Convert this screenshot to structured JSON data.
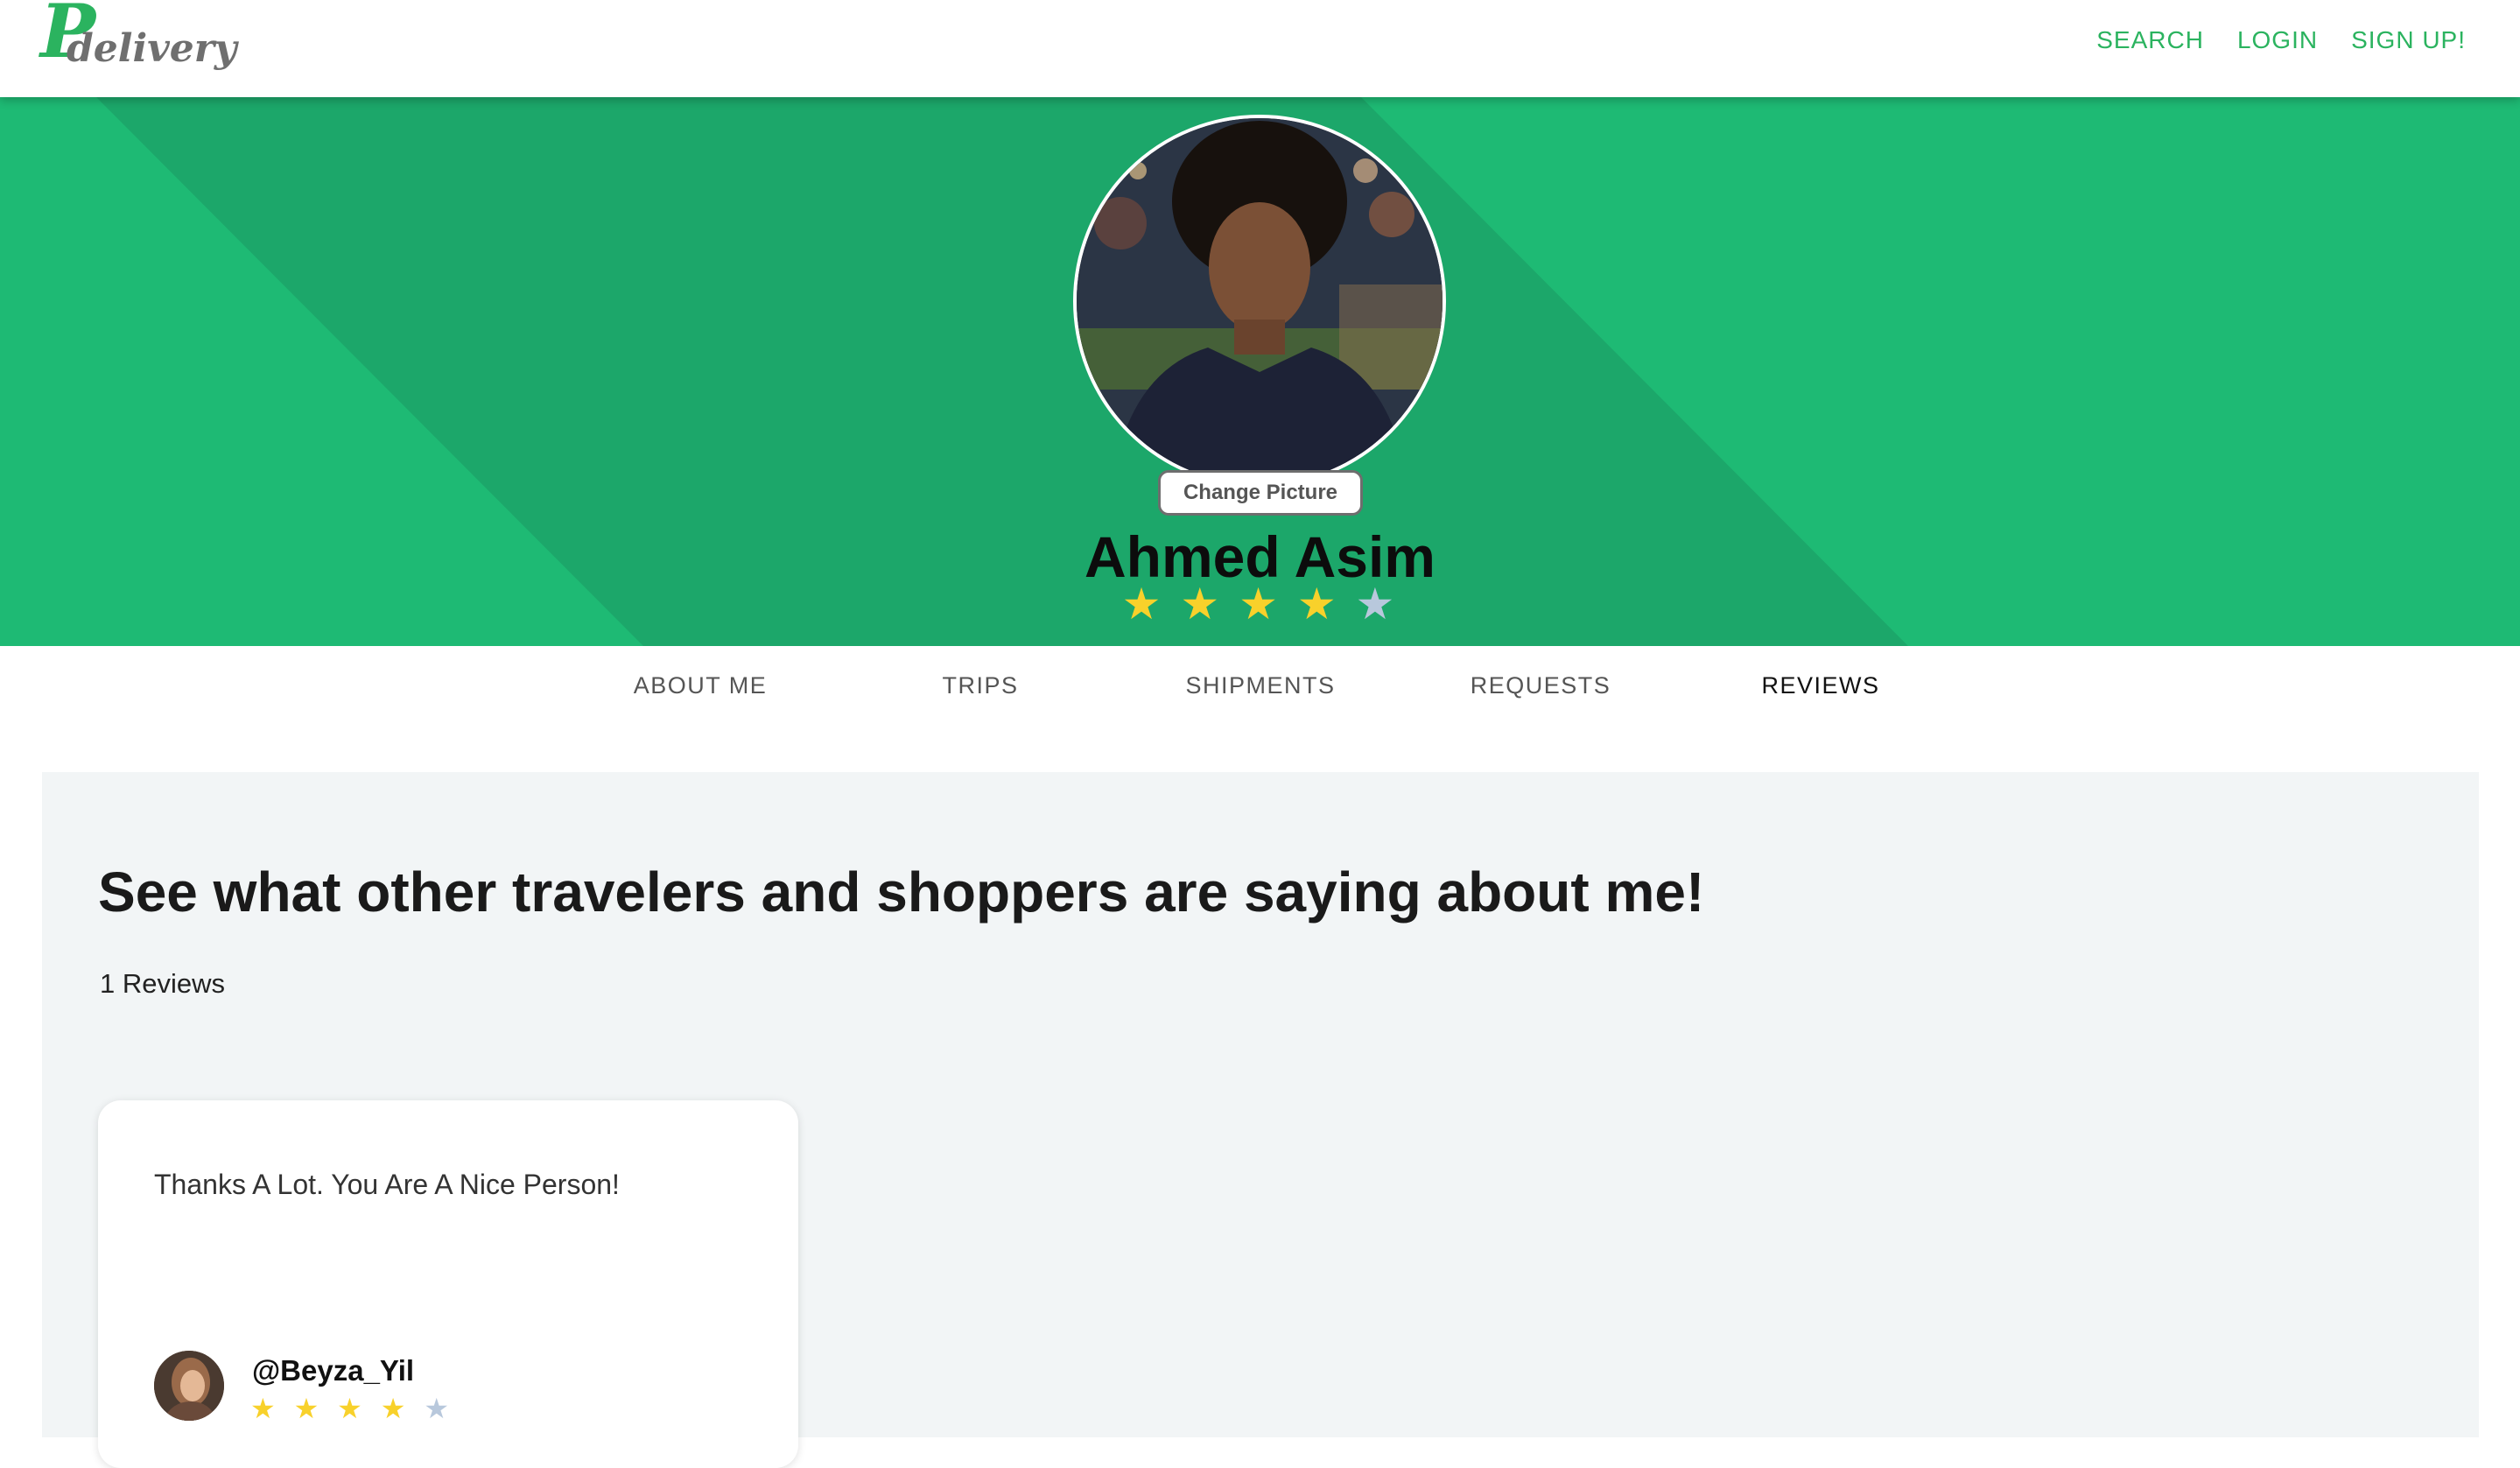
{
  "brand": {
    "logo_letter": "P",
    "logo_word": "delivery",
    "green": "#2bb35f",
    "hero_green": "#1eba74",
    "hero_band": "#1ca76a"
  },
  "nav": {
    "search": "SEARCH",
    "login": "LOGIN",
    "signup": "SIGN UP!"
  },
  "profile": {
    "avatar_icon": "profile-photo",
    "change_picture_label": "Change Picture",
    "name": "Ahmed Asim",
    "rating": 4,
    "rating_max": 5,
    "stars": [
      "★",
      "★",
      "★",
      "★",
      "★"
    ]
  },
  "tabs": [
    {
      "label": "ABOUT ME",
      "active": false
    },
    {
      "label": "TRIPS",
      "active": false
    },
    {
      "label": "SHIPMENTS",
      "active": false
    },
    {
      "label": "REQUESTS",
      "active": false
    },
    {
      "label": "REVIEWS",
      "active": true
    }
  ],
  "reviews": {
    "heading": "See what other travelers and shoppers are saying about me!",
    "count_text": "1 Reviews",
    "items": [
      {
        "text": "Thanks A Lot. You Are A Nice Person!",
        "reviewer": "@Beyza_Yil",
        "rating": 4,
        "rating_max": 5,
        "stars": [
          "★",
          "★",
          "★",
          "★",
          "★"
        ]
      }
    ]
  }
}
